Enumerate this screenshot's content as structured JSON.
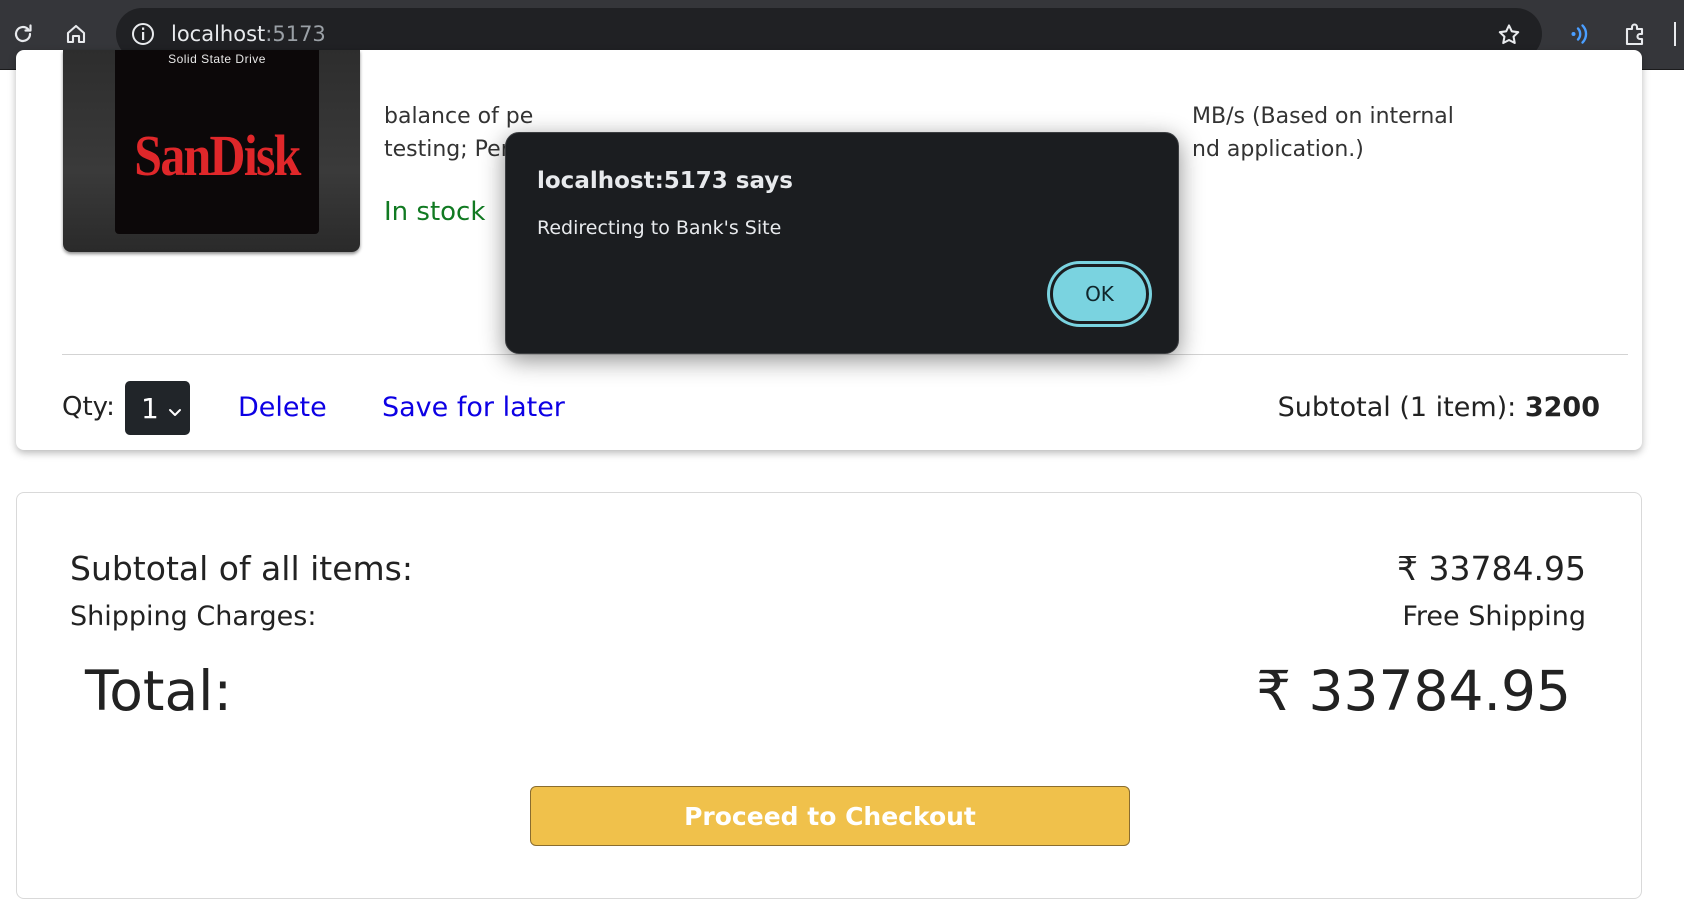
{
  "browser": {
    "url_host": "localhost",
    "url_port": ":5173",
    "icons": [
      "reload-icon",
      "home-icon",
      "site-info-icon",
      "bookmark-star-icon",
      "read-aloud-icon",
      "extensions-icon"
    ]
  },
  "product": {
    "image_label_top": "Solid State Drive",
    "image_brand": "SanDisk",
    "description_line1_left": "balance of pe",
    "description_line1_right": "MB/s (Based on internal",
    "description_line2_left": "testing; Perfor",
    "description_line2_right": "nd application.)",
    "stock_status": "In stock",
    "stock_color": "#117a22"
  },
  "cart_actions": {
    "qty_label": "Qty:",
    "qty_value": "1",
    "delete_label": "Delete",
    "save_for_later_label": "Save for later",
    "subtotal_label": "Subtotal (1 item): ",
    "subtotal_value": "3200",
    "link_color": "#0d00e4"
  },
  "summary": {
    "subtotal_label": "Subtotal of all items:",
    "subtotal_value": "₹ 33784.95",
    "shipping_label": "Shipping Charges:",
    "shipping_value": "Free Shipping",
    "total_label": "Total:",
    "total_value": "₹ 33784.95",
    "checkout_label": "Proceed to Checkout",
    "checkout_color": "#f0c14b"
  },
  "alert": {
    "title": "localhost:5173 says",
    "message": "Redirecting to Bank's Site",
    "ok_label": "OK",
    "ok_color": "#7ad3e0"
  }
}
